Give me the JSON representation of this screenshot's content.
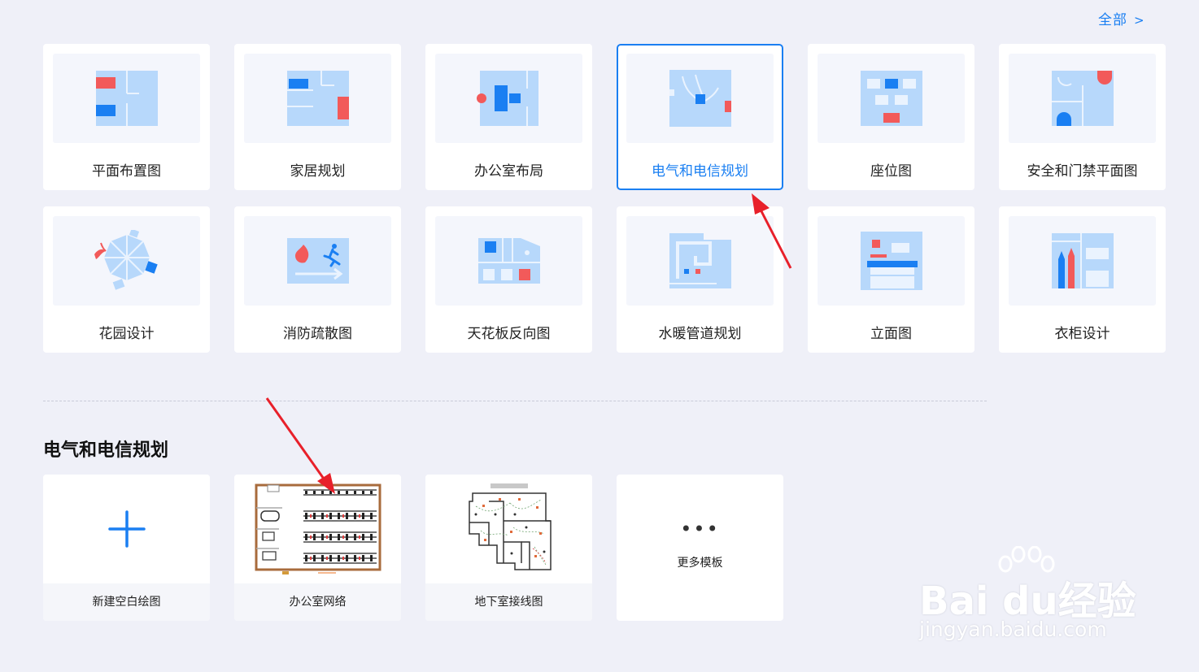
{
  "header": {
    "all_label": "全部",
    "all_chevron": ">"
  },
  "categories": [
    {
      "label": "平面布置图",
      "icon": "floor-plan-icon"
    },
    {
      "label": "家居规划",
      "icon": "home-plan-icon"
    },
    {
      "label": "办公室布局",
      "icon": "office-layout-icon"
    },
    {
      "label": "电气和电信规划",
      "icon": "electrical-plan-icon",
      "selected": true
    },
    {
      "label": "座位图",
      "icon": "seating-chart-icon"
    },
    {
      "label": "安全和门禁平面图",
      "icon": "security-plan-icon"
    },
    {
      "label": "花园设计",
      "icon": "garden-icon"
    },
    {
      "label": "消防疏散图",
      "icon": "fire-evacuation-icon"
    },
    {
      "label": "天花板反向图",
      "icon": "ceiling-plan-icon"
    },
    {
      "label": "水暖管道规划",
      "icon": "plumbing-icon"
    },
    {
      "label": "立面图",
      "icon": "elevation-icon"
    },
    {
      "label": "衣柜设计",
      "icon": "wardrobe-icon"
    }
  ],
  "section": {
    "title": "电气和电信规划",
    "templates": [
      {
        "label": "新建空白绘图",
        "icon": "plus-icon"
      },
      {
        "label": "办公室网络",
        "icon": "office-network-preview"
      },
      {
        "label": "地下室接线图",
        "icon": "basement-wiring-preview"
      },
      {
        "label": "更多模板",
        "icon": "more-dots-icon",
        "dots": "•••"
      }
    ]
  },
  "watermark": {
    "brand": "Bai du经验",
    "url": "jingyan.baidu.com"
  },
  "colors": {
    "accent": "#1a7ff2",
    "light_blue": "#b7d8fb",
    "mid_blue": "#1a7ff2",
    "red": "#f25a5a",
    "background": "#eff0f8"
  }
}
